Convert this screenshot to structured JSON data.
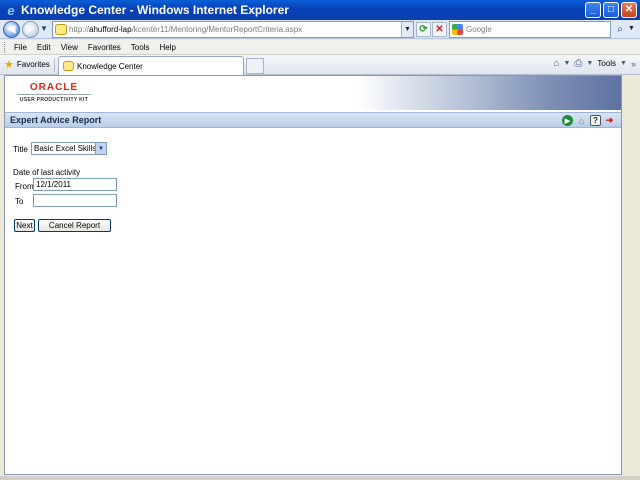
{
  "window": {
    "title": "Knowledge Center - Windows Internet Explorer",
    "minimize": "_",
    "maximize": "□",
    "close": "✕"
  },
  "address_bar": {
    "url_prefix": "http://",
    "url_host": "ahufford-lap",
    "url_path": "/kcenter11/Mentoring/MentorReportCriteria.aspx",
    "search_placeholder": "Google"
  },
  "menu": {
    "items": [
      "File",
      "Edit",
      "View",
      "Favorites",
      "Tools",
      "Help"
    ]
  },
  "favorites_bar": {
    "favorites_label": "Favorites",
    "tab_title": "Knowledge Center",
    "tools_label": "Tools"
  },
  "banner": {
    "logo_top": "ORACLE",
    "logo_bottom": "USER PRODUCTIVITY KIT"
  },
  "page": {
    "title": "Expert Advice Report"
  },
  "form": {
    "title_label": "Title",
    "title_selected": "Basic Excel Skills",
    "date_section_label": "Date of last activity",
    "from_label": "From",
    "from_value": "12/1/2011",
    "to_label": "To",
    "to_value": "",
    "next_label": "Next",
    "cancel_label": "Cancel Report"
  },
  "colors": {
    "accent": "#0a3fae",
    "oracle_red": "#e0251b",
    "header_bar": "#c9d9ef"
  }
}
